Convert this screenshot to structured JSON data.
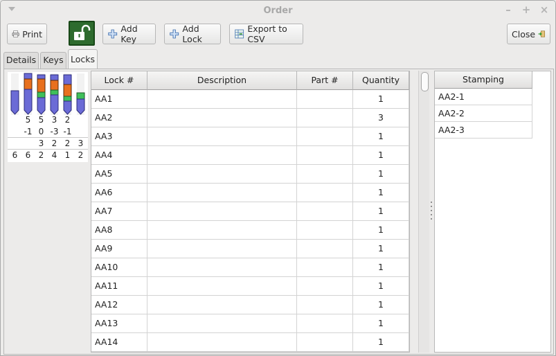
{
  "window": {
    "title": "Order"
  },
  "toolbar": {
    "print_label": "Print",
    "add_key_label": "Add Key",
    "add_lock_label": "Add Lock",
    "export_label": "Export to CSV",
    "close_label": "Close"
  },
  "tabs": [
    {
      "label": "Details",
      "active": false
    },
    {
      "label": "Keys",
      "active": false
    },
    {
      "label": "Locks",
      "active": true
    }
  ],
  "pin_diagram": {
    "colors": {
      "bottom_pin": "#6b6bd6",
      "master_pin": "#3fbf5a",
      "driver_pin": "#e8701e"
    },
    "row1": [
      "",
      "5",
      "5",
      "3",
      "2",
      ""
    ],
    "row2": [
      "",
      "-1",
      "0",
      "-3",
      "-1",
      ""
    ],
    "row3": [
      "",
      "",
      "3",
      "2",
      "2",
      "3"
    ],
    "row4": [
      "6",
      "6",
      "2",
      "4",
      "1",
      "2"
    ]
  },
  "locks_table": {
    "columns": [
      "Lock #",
      "Description",
      "Part #",
      "Quantity"
    ],
    "rows": [
      {
        "lock": "AA1",
        "description": "",
        "part": "",
        "quantity": "1"
      },
      {
        "lock": "AA2",
        "description": "",
        "part": "",
        "quantity": "3"
      },
      {
        "lock": "AA3",
        "description": "",
        "part": "",
        "quantity": "1"
      },
      {
        "lock": "AA4",
        "description": "",
        "part": "",
        "quantity": "1"
      },
      {
        "lock": "AA5",
        "description": "",
        "part": "",
        "quantity": "1"
      },
      {
        "lock": "AA6",
        "description": "",
        "part": "",
        "quantity": "1"
      },
      {
        "lock": "AA7",
        "description": "",
        "part": "",
        "quantity": "1"
      },
      {
        "lock": "AA8",
        "description": "",
        "part": "",
        "quantity": "1"
      },
      {
        "lock": "AA9",
        "description": "",
        "part": "",
        "quantity": "1"
      },
      {
        "lock": "AA10",
        "description": "",
        "part": "",
        "quantity": "1"
      },
      {
        "lock": "AA11",
        "description": "",
        "part": "",
        "quantity": "1"
      },
      {
        "lock": "AA12",
        "description": "",
        "part": "",
        "quantity": "1"
      },
      {
        "lock": "AA13",
        "description": "",
        "part": "",
        "quantity": "1"
      },
      {
        "lock": "AA14",
        "description": "",
        "part": "",
        "quantity": "1"
      }
    ]
  },
  "stamping_table": {
    "column": "Stamping",
    "rows": [
      "AA2-1",
      "AA2-2",
      "AA2-3"
    ]
  },
  "icons": {
    "print": "printer-icon",
    "lock_toggle": "padlock-open-icon",
    "add_key": "plus-icon",
    "add_lock": "plus-icon",
    "export": "spreadsheet-icon",
    "close": "exit-door-icon"
  }
}
